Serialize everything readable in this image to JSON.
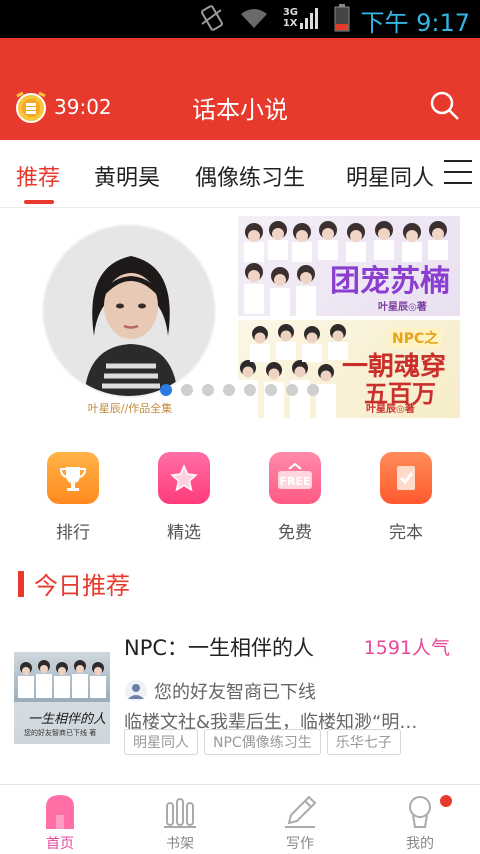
{
  "status_bar": {
    "network_top": "3G",
    "network_bottom": "1X",
    "time": "下午 9:17"
  },
  "header": {
    "timer": "39:02",
    "title": "话本小说"
  },
  "tabs": [
    {
      "label": "推荐"
    },
    {
      "label": "黄明昊"
    },
    {
      "label": "偶像练习生"
    },
    {
      "label": "明星同人"
    }
  ],
  "banner": {
    "avatar_caption": "叶星辰//作品全集",
    "cover1": {
      "title": "团宠苏楠",
      "author": "叶星辰◎著"
    },
    "cover2": {
      "tag": "NPC之",
      "title_line1": "一朝魂穿",
      "title_line2": "五百万",
      "author": "叶星辰◎著"
    },
    "dot_count": 8,
    "active_dot": 0
  },
  "quick_entries": [
    {
      "label": "排行",
      "icon": "trophy-icon",
      "color": "#ff9a2e"
    },
    {
      "label": "精选",
      "icon": "star-icon",
      "color": "#ff4f8b"
    },
    {
      "label": "免费",
      "icon": "free-tag-icon",
      "color": "#ff6a8e"
    },
    {
      "label": "完本",
      "icon": "checklist-icon",
      "color": "#ff6a3d"
    }
  ],
  "section": {
    "title": "今日推荐"
  },
  "book": {
    "title": "NPC：一生相伴的人",
    "popularity": "1591人气",
    "author": "您的好友智商已下线",
    "description": "临楼文社&我辈后生，临楼知渺“明…",
    "cover_text": "一生相伴的人",
    "cover_subtext": "您的好友智商已下线 著",
    "tags": [
      "明星同人",
      "NPC偶像练习生",
      "乐华七子"
    ]
  },
  "bottom_nav": [
    {
      "label": "首页",
      "icon": "home-icon",
      "active": true
    },
    {
      "label": "书架",
      "icon": "bookshelf-icon",
      "active": false
    },
    {
      "label": "写作",
      "icon": "pen-icon",
      "active": false
    },
    {
      "label": "我的",
      "icon": "profile-icon",
      "active": false
    }
  ],
  "colors": {
    "brand": "#e8392d",
    "accent_pink": "#e8489a",
    "status_time": "#33b5e5"
  }
}
